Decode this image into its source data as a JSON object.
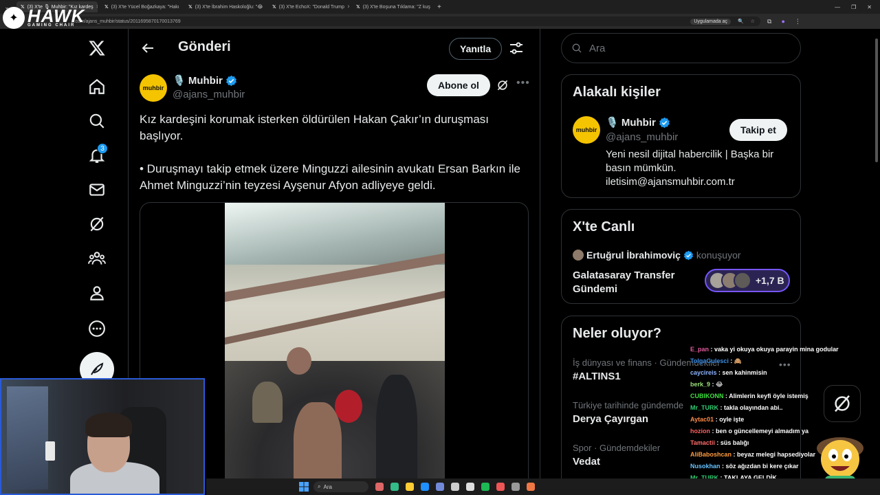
{
  "browser": {
    "tabs": [
      {
        "title": "(3) X'te  🎙 Muhbir: \"Kız kardeş",
        "active": true
      },
      {
        "title": "(3) X'te Yücel Boğazkaya: \"Hakı",
        "active": false
      },
      {
        "title": "(3) X'te İbrahim Haskoloğlu: \"😂",
        "active": false
      },
      {
        "title": "(3) X'te EchoX: \"Donald Trump",
        "active": false
      },
      {
        "title": "(3) X'te Boşuna Tıklama: \"Z kuş",
        "active": false
      }
    ],
    "url": "x.com/ajans_muhbir/status/2011695870170013769",
    "install_app": "Uygulamada aç"
  },
  "overlay_logo": {
    "word": "HAWK",
    "sub": "GAMING CHAIR"
  },
  "nav": {
    "notifications_count": "3",
    "icons": [
      "x-logo-icon",
      "home-icon",
      "search-icon",
      "bell-icon",
      "mail-icon",
      "grok-icon",
      "communities-icon",
      "profile-icon",
      "more-icon"
    ]
  },
  "header": {
    "title": "Gönderi",
    "reply_button": "Yanıtla"
  },
  "post": {
    "author_name": "🎙️ Muhbir",
    "author_handle": "@ajans_muhbir",
    "avatar_text": "muhbir",
    "subscribe_button": "Abone ol",
    "paragraph1": "Kız kardeşini korumak isterken öldürülen Hakan Çakır’ın duruşması başlıyor.",
    "paragraph2": "• Duruşmayı takip etmek üzere Minguzzi ailesinin avukatı Ersan Barkın ile Ahmet Minguzzi’nin teyzesi Ayşenur Afyon adliyeye geldi."
  },
  "search": {
    "placeholder": "Ara"
  },
  "related": {
    "title": "Alakalı kişiler",
    "name": "🎙️ Muhbir",
    "handle": "@ajans_muhbir",
    "avatar_text": "muhbir",
    "follow_button": "Takip et",
    "bio": "Yeni nesil dijital habercilik | Başka bir basın mümkün. iletisim@ajansmuhbir.com.tr"
  },
  "live": {
    "title": "X'te Canlı",
    "host": "Ertuğrul İbrahimoviç",
    "host_state": "konuşuyor",
    "space_title": "Galatasaray Transfer Gündemi",
    "listeners": "+1,7 B"
  },
  "trends": {
    "title": "Neler oluyor?",
    "items": [
      {
        "context": "İş dünyası ve finans · Gündemdekiler",
        "topic": "#ALTINS1"
      },
      {
        "context": "Türkiye tarihinde gündemde",
        "topic": "Derya Çayırgan"
      },
      {
        "context": "Spor · Gündemdekiler",
        "topic": "Vedat"
      }
    ]
  },
  "chat": [
    {
      "user": "E_pan",
      "color": "#e05a9a",
      "msg": "vaka yi okuya okuya parayin mina godular"
    },
    {
      "user": "TolgaGulesci",
      "color": "#3a8ee6",
      "msg": "🙈"
    },
    {
      "user": "caycireis",
      "color": "#8fb4ff",
      "msg": "sen kahinmisin"
    },
    {
      "user": "berk_9",
      "color": "#9ae07a",
      "msg": "😂"
    },
    {
      "user": "CUBIKONN",
      "color": "#40e040",
      "msg": "Alimlerin keyfi öyle istemiş"
    },
    {
      "user": "Mr_TURK",
      "color": "#2ecc71",
      "msg": "takla olayından abi.."
    },
    {
      "user": "Aytac01",
      "color": "#ff8b4a",
      "msg": "oyle işte"
    },
    {
      "user": "hozion",
      "color": "#ff5f5f",
      "msg": "ben o güncellemeyi almadım ya"
    },
    {
      "user": "Tamactii",
      "color": "#ff6a6a",
      "msg": "süs balığı"
    },
    {
      "user": "AliBaboshcan",
      "color": "#ff9b3d",
      "msg": "beyaz melegi hapsediyolar"
    },
    {
      "user": "Nusokhan",
      "color": "#66c2ff",
      "msg": "söz ağızdan bi kere çıkar"
    },
    {
      "user": "Mr_TURK",
      "color": "#2ecc71",
      "msg": "TAKLAYA GELDİK"
    }
  ],
  "taskbar": {
    "search": "Ara"
  },
  "colors": {
    "accent": "#1d9bf0",
    "live_border": "#7856ff",
    "avatar_yellow": "#f5c400"
  }
}
